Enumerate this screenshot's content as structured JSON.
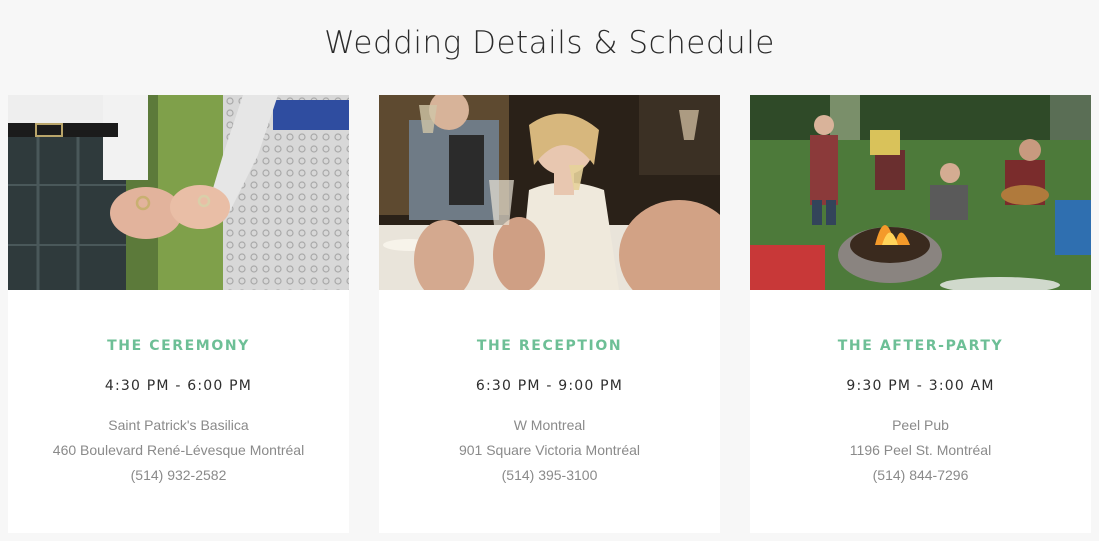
{
  "page": {
    "title": "Wedding Details & Schedule"
  },
  "accent_color": "#6dbf96",
  "events": [
    {
      "title": "THE CEREMONY",
      "time": "4:30 PM - 6:00 PM",
      "venue": "Saint Patrick's Basilica",
      "address": "460 Boulevard René-Lévesque Montréal",
      "phone": "(514) 932-2582",
      "image": "ceremony-rings-photo"
    },
    {
      "title": "THE RECEPTION",
      "time": "6:30 PM - 9:00 PM",
      "venue": "W Montreal",
      "address": "901 Square Victoria Montréal",
      "phone": "(514) 395-3100",
      "image": "reception-toast-photo"
    },
    {
      "title": "THE AFTER-PARTY",
      "time": "9:30 PM - 3:00 AM",
      "venue": "Peel Pub",
      "address": "1196 Peel St. Montréal",
      "phone": "(514) 844-7296",
      "image": "campfire-party-photo"
    }
  ]
}
